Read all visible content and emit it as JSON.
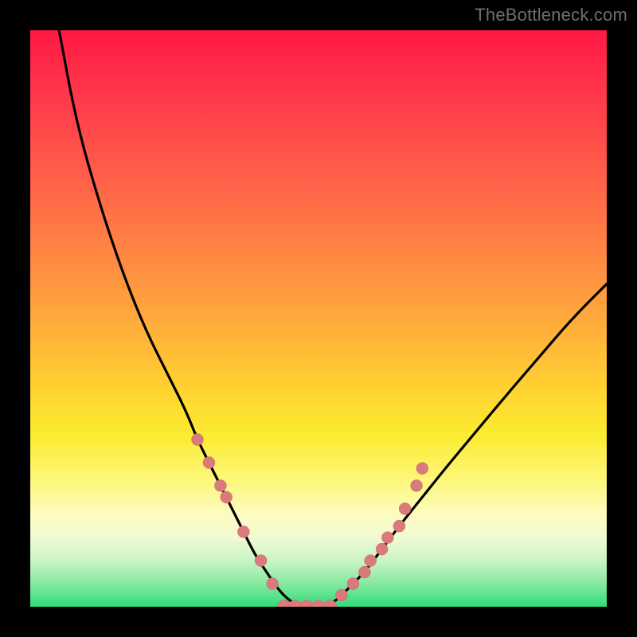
{
  "watermark": "TheBottleneck.com",
  "colors": {
    "background": "#000000",
    "curve": "#000000",
    "dot_fill": "#d97a7c",
    "dot_stroke": "#c96a6c",
    "gradient_stops": [
      "#ff1944",
      "#ff3a4b",
      "#ff6149",
      "#ff8a42",
      "#ffb03a",
      "#ffd131",
      "#fceb2f",
      "#fdf779",
      "#fdfcc0",
      "#f1fad4",
      "#c9f4c4",
      "#86e9a0",
      "#2fdc7a"
    ]
  },
  "chart_data": {
    "type": "line",
    "title": "",
    "xlabel": "",
    "ylabel": "",
    "xlim": [
      0,
      100
    ],
    "ylim": [
      0,
      100
    ],
    "x": [
      5,
      8,
      12,
      16,
      20,
      24,
      27,
      29,
      31,
      33,
      35,
      37,
      39,
      41,
      43,
      45,
      47,
      49,
      51,
      53,
      55,
      58,
      61,
      64,
      68,
      72,
      77,
      82,
      88,
      94,
      100
    ],
    "values": [
      100,
      84,
      70,
      58,
      48,
      40,
      34,
      29,
      25,
      21,
      17,
      13,
      9,
      6,
      3,
      1,
      0,
      0,
      0,
      1,
      3,
      6,
      10,
      14,
      19,
      24,
      30,
      36,
      43,
      50,
      56
    ],
    "series": [
      {
        "name": "bottleneck-curve",
        "x": [
          5,
          8,
          12,
          16,
          20,
          24,
          27,
          29,
          31,
          33,
          35,
          37,
          39,
          41,
          43,
          45,
          47,
          49,
          51,
          53,
          55,
          58,
          61,
          64,
          68,
          72,
          77,
          82,
          88,
          94,
          100
        ],
        "y": [
          100,
          84,
          70,
          58,
          48,
          40,
          34,
          29,
          25,
          21,
          17,
          13,
          9,
          6,
          3,
          1,
          0,
          0,
          0,
          1,
          3,
          6,
          10,
          14,
          19,
          24,
          30,
          36,
          43,
          50,
          56
        ]
      }
    ],
    "marker_points": {
      "left_branch": [
        [
          29,
          29
        ],
        [
          31,
          25
        ],
        [
          33,
          21
        ],
        [
          34,
          19
        ],
        [
          37,
          13
        ],
        [
          40,
          8
        ],
        [
          42,
          4
        ]
      ],
      "right_branch": [
        [
          54,
          2
        ],
        [
          56,
          4
        ],
        [
          58,
          6
        ],
        [
          59,
          8
        ],
        [
          61,
          10
        ],
        [
          62,
          12
        ],
        [
          64,
          14
        ],
        [
          65,
          17
        ],
        [
          67,
          21
        ],
        [
          68,
          24
        ]
      ],
      "bottom_flat": [
        [
          44,
          0
        ],
        [
          46,
          0
        ],
        [
          48,
          0
        ],
        [
          50,
          0
        ],
        [
          52,
          0
        ]
      ]
    }
  }
}
